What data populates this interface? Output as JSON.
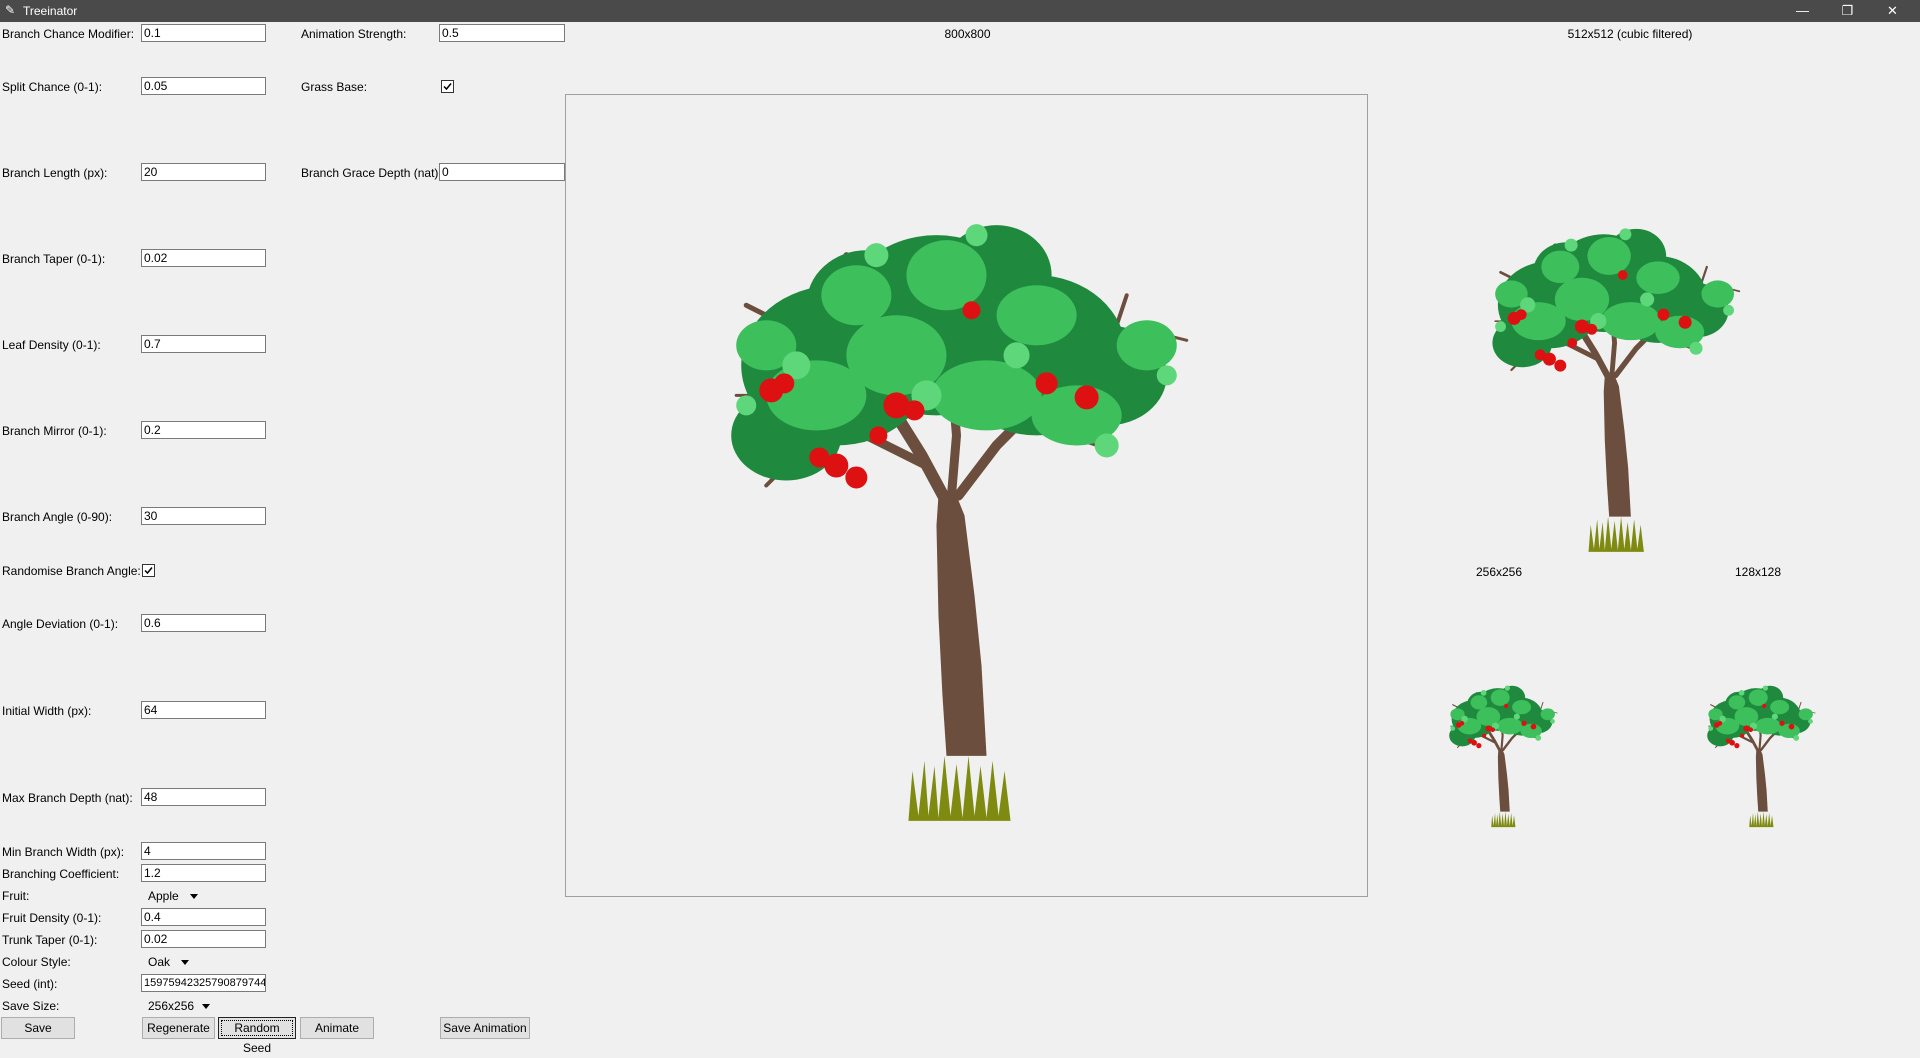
{
  "window": {
    "title": "Treeinator"
  },
  "form": {
    "branch_chance_modifier": {
      "label": "Branch Chance Modifier:",
      "value": "0.1"
    },
    "split_chance": {
      "label": "Split Chance (0-1):",
      "value": "0.05"
    },
    "branch_length": {
      "label": "Branch Length (px):",
      "value": "20"
    },
    "branch_taper": {
      "label": "Branch Taper (0-1):",
      "value": "0.02"
    },
    "leaf_density": {
      "label": "Leaf Density (0-1):",
      "value": "0.7"
    },
    "branch_mirror": {
      "label": "Branch Mirror (0-1):",
      "value": "0.2"
    },
    "branch_angle": {
      "label": "Branch Angle (0-90):",
      "value": "30"
    },
    "randomise_branch_angle": {
      "label": "Randomise Branch Angle:",
      "checked": true
    },
    "angle_deviation": {
      "label": "Angle Deviation (0-1):",
      "value": "0.6"
    },
    "initial_width": {
      "label": "Initial Width (px):",
      "value": "64"
    },
    "max_branch_depth": {
      "label": "Max Branch Depth (nat):",
      "value": "48"
    },
    "min_branch_width": {
      "label": "Min Branch Width (px):",
      "value": "4"
    },
    "branching_coefficient": {
      "label": "Branching Coefficient:",
      "value": "1.2"
    },
    "fruit": {
      "label": "Fruit:",
      "value": "Apple"
    },
    "fruit_density": {
      "label": "Fruit Density (0-1):",
      "value": "0.4"
    },
    "trunk_taper": {
      "label": "Trunk Taper (0-1):",
      "value": "0.02"
    },
    "colour_style": {
      "label": "Colour Style:",
      "value": "Oak"
    },
    "seed": {
      "label": "Seed (int):",
      "value": "15975942325790879744"
    },
    "save_size": {
      "label": "Save Size:",
      "value": "256x256"
    },
    "animation_strength": {
      "label": "Animation Strength:",
      "value": "0.5"
    },
    "grass_base": {
      "label": "Grass Base:",
      "checked": true
    },
    "branch_grace_depth": {
      "label": "Branch Grace Depth (nat):",
      "value": "0"
    }
  },
  "buttons": {
    "save": "Save",
    "regenerate": "Regenerate",
    "random_seed": "Random Seed",
    "animate": "Animate",
    "save_animation": "Save Animation"
  },
  "previews": {
    "main": "800x800",
    "large": "512x512 (cubic filtered)",
    "medium": "256x256",
    "small": "128x128"
  },
  "colors": {
    "trunk": "#6b4e3d",
    "leaf_dark": "#1f8a3e",
    "leaf_light": "#3dbf5c",
    "fruit": "#dd1111",
    "grass": "#7f8a10"
  }
}
